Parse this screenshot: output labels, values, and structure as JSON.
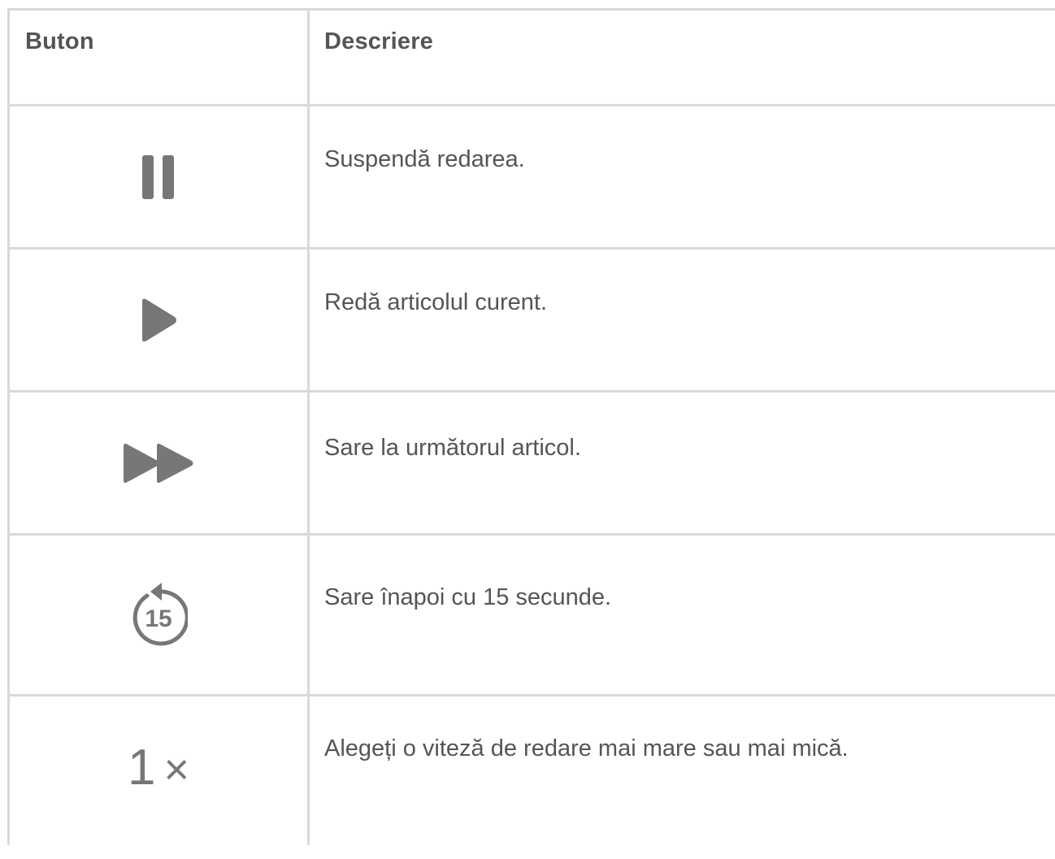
{
  "table": {
    "headers": {
      "button": "Buton",
      "description": "Descriere"
    },
    "rows": [
      {
        "icon": "pause-icon",
        "description": "Suspendă redarea."
      },
      {
        "icon": "play-icon",
        "description": "Redă articolul curent."
      },
      {
        "icon": "fast-forward-icon",
        "description": "Sare la următorul articol."
      },
      {
        "icon": "skip-back-15-icon",
        "icon_label": "15",
        "description": "Sare înapoi cu 15 secunde."
      },
      {
        "icon": "playback-speed-icon",
        "icon_label": "1",
        "icon_symbol": "×",
        "description": "Alegeți o viteză de redare mai mare sau mai mică."
      }
    ]
  },
  "colors": {
    "text": "#555555",
    "icon": "#777777",
    "border": "#d9d9d9"
  }
}
